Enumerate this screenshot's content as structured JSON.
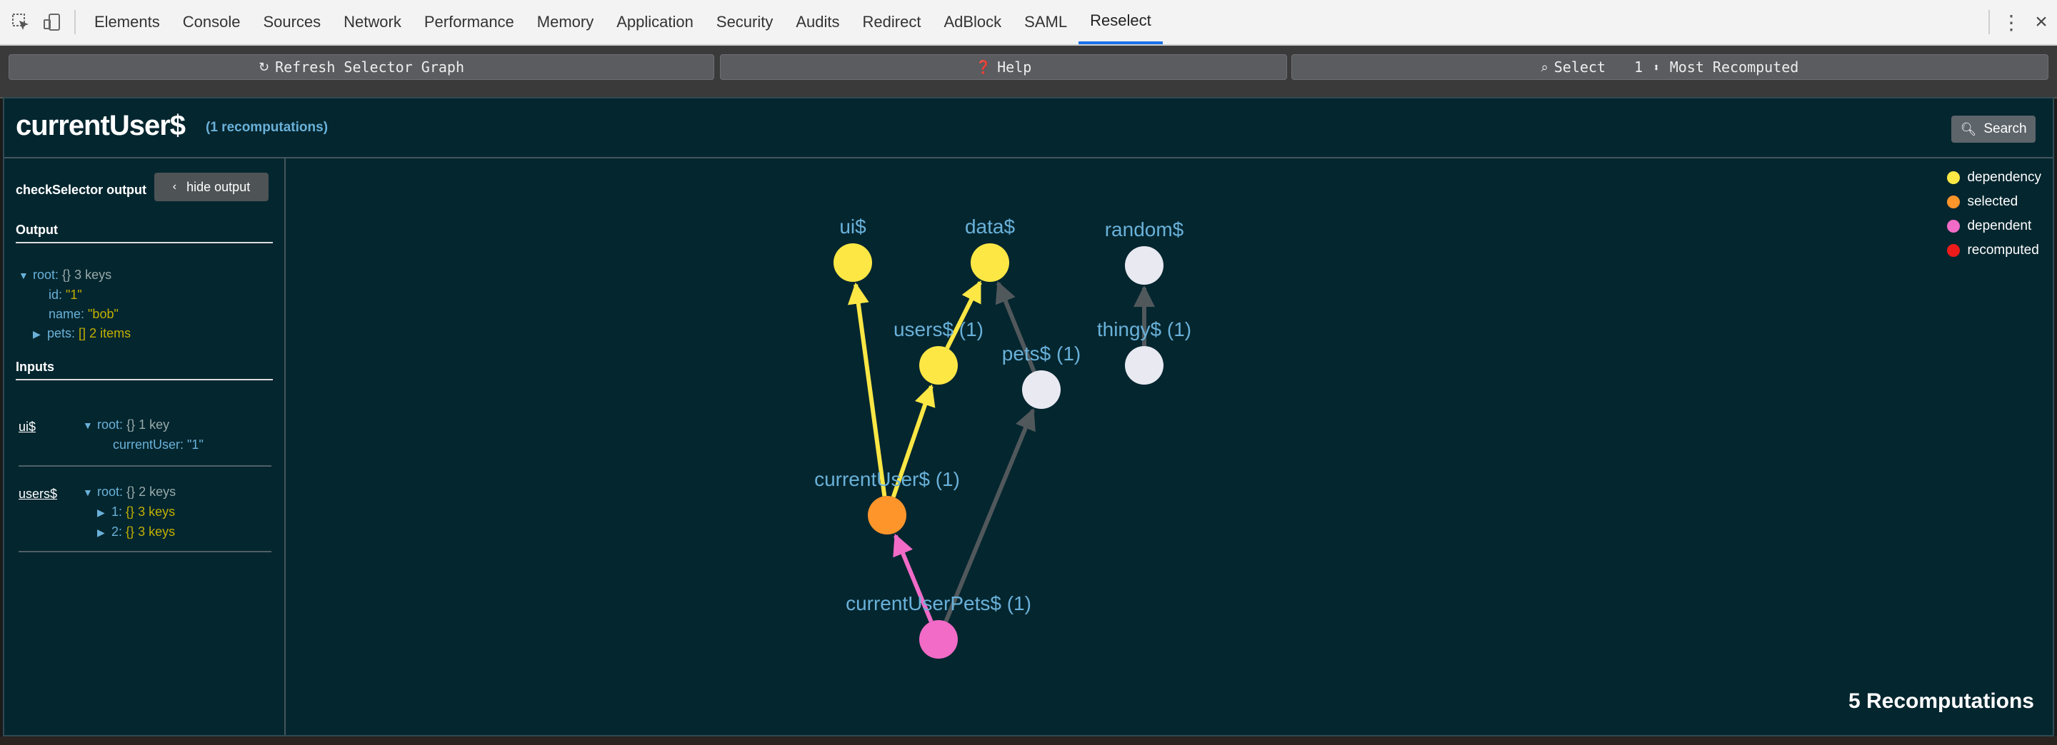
{
  "devtools": {
    "tabs": [
      "Elements",
      "Console",
      "Sources",
      "Network",
      "Performance",
      "Memory",
      "Application",
      "Security",
      "Audits",
      "Redirect",
      "AdBlock",
      "SAML",
      "Reselect"
    ],
    "active_tab": "Reselect"
  },
  "toolbar": {
    "refresh_label": "Refresh Selector Graph",
    "help_label": "Help",
    "select_label": "Select",
    "select_count": "1",
    "select_mode": "Most Recomputed"
  },
  "header": {
    "title": "currentUser$",
    "recomputations": "(1 recomputations)",
    "search_label": "Search"
  },
  "sidebar": {
    "title": "checkSelector output",
    "hide_label": "hide output",
    "output_heading": "Output",
    "inputs_heading": "Inputs",
    "output_tree": {
      "root_key": "root:",
      "root_type": "{}",
      "root_count": "3 keys",
      "id_key": "id:",
      "id_val": "\"1\"",
      "name_key": "name:",
      "name_val": "\"bob\"",
      "pets_key": "pets:",
      "pets_type": "[]",
      "pets_count": "2 items"
    },
    "inputs": [
      {
        "name": "ui$",
        "root_key": "root:",
        "root_type": "{}",
        "root_count": "1 key",
        "child_key": "currentUser:",
        "child_val": "\"1\""
      },
      {
        "name": "users$",
        "root_key": "root:",
        "root_type": "{}",
        "root_count": "2 keys",
        "items": [
          {
            "key": "1:",
            "type": "{}",
            "count": "3 keys"
          },
          {
            "key": "2:",
            "type": "{}",
            "count": "3 keys"
          }
        ]
      }
    ]
  },
  "graph": {
    "colors": {
      "dependency": "#fde745",
      "selected": "#fd952b",
      "dependent": "#f26bc7",
      "recomputed": "#ee1b1b",
      "neutral": "#e9e9f2",
      "edge_neutral": "#51585c",
      "label": "#6ab1d9"
    },
    "nodes": [
      {
        "id": "ui",
        "label": "ui$",
        "kind": "dependency"
      },
      {
        "id": "data",
        "label": "data$",
        "kind": "dependency"
      },
      {
        "id": "random",
        "label": "random$",
        "kind": "neutral"
      },
      {
        "id": "users",
        "label": "users$ (1)",
        "kind": "dependency"
      },
      {
        "id": "pets",
        "label": "pets$ (1)",
        "kind": "neutral"
      },
      {
        "id": "thingy",
        "label": "thingy$ (1)",
        "kind": "neutral"
      },
      {
        "id": "currentUser",
        "label": "currentUser$ (1)",
        "kind": "selected"
      },
      {
        "id": "currentUserPets",
        "label": "currentUserPets$ (1)",
        "kind": "dependent"
      }
    ],
    "edges": [
      {
        "from": "currentUser",
        "to": "ui",
        "kind": "dependency"
      },
      {
        "from": "currentUser",
        "to": "users",
        "kind": "dependency"
      },
      {
        "from": "users",
        "to": "data",
        "kind": "dependency"
      },
      {
        "from": "pets",
        "to": "data",
        "kind": "neutral"
      },
      {
        "from": "thingy",
        "to": "random",
        "kind": "neutral"
      },
      {
        "from": "currentUserPets",
        "to": "currentUser",
        "kind": "dependent"
      },
      {
        "from": "currentUserPets",
        "to": "pets",
        "kind": "neutral"
      }
    ],
    "legend": [
      {
        "label": "dependency",
        "color": "#fde745"
      },
      {
        "label": "selected",
        "color": "#fd952b"
      },
      {
        "label": "dependent",
        "color": "#f26bc7"
      },
      {
        "label": "recomputed",
        "color": "#ee1b1b"
      }
    ],
    "total": "5 Recomputations"
  }
}
